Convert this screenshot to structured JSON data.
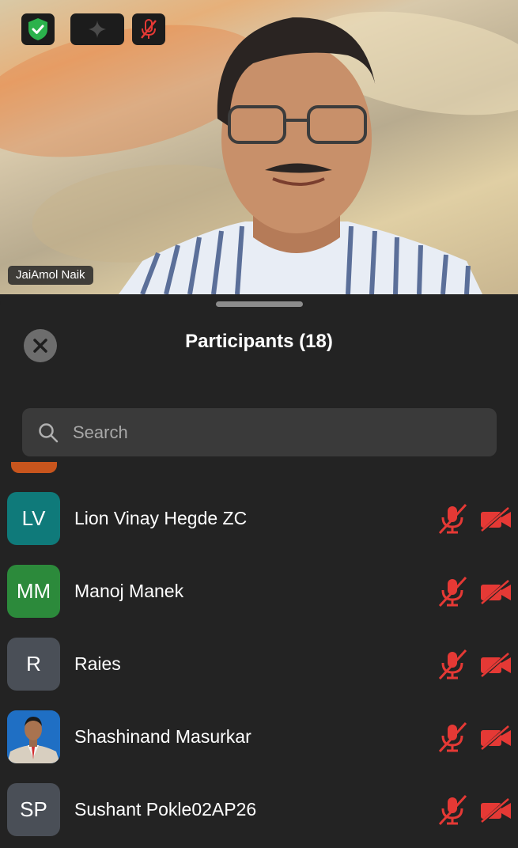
{
  "video": {
    "speaker_name": "JaiAmol Naik",
    "top_icons": [
      "shield-check-icon",
      "sparkle-icon",
      "mic-muted-icon"
    ]
  },
  "panel": {
    "title": "Participants (18)",
    "close_icon": "close-icon",
    "search_placeholder": "Search"
  },
  "participants": [
    {
      "initials": "LV",
      "name": "Lion Vinay Hegde ZC",
      "avatar_color": "#0f7a7a",
      "mic": "muted",
      "video": "off"
    },
    {
      "initials": "MM",
      "name": "Manoj Manek",
      "avatar_color": "#2c8a3b",
      "mic": "muted",
      "video": "off"
    },
    {
      "initials": "R",
      "name": "Raies",
      "avatar_color": "#4a4f57",
      "mic": "muted",
      "video": "off"
    },
    {
      "initials": "",
      "name": "Shashinand Masurkar",
      "avatar_color": "#1f6fc4",
      "avatar_photo": true,
      "mic": "muted",
      "video": "off"
    },
    {
      "initials": "SP",
      "name": "Sushant Pokle02AP26",
      "avatar_color": "#4a4f57",
      "mic": "muted",
      "video": "off"
    }
  ],
  "colors": {
    "muted_red": "#e53935",
    "shield_green": "#2bb24c",
    "sheet_bg": "#232323"
  }
}
